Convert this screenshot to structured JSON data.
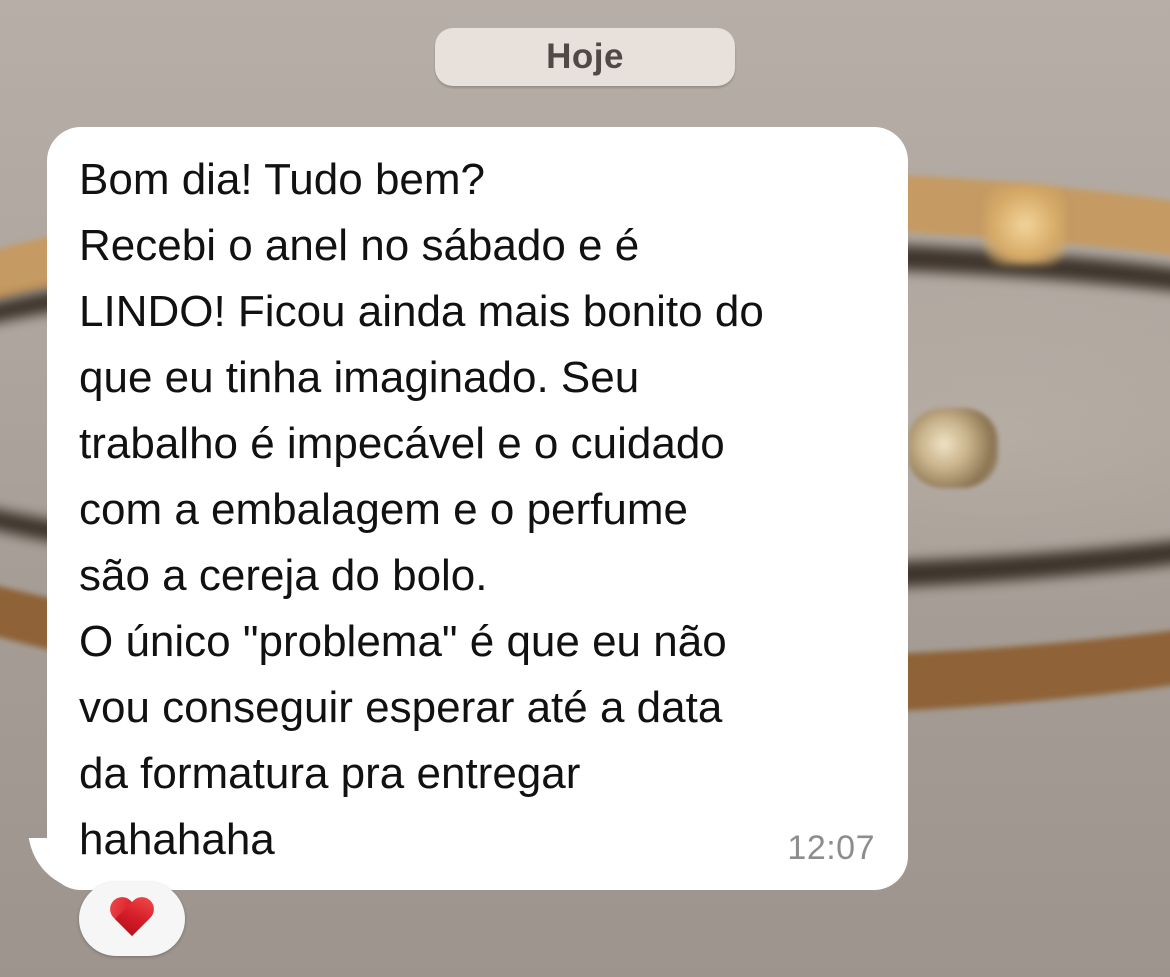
{
  "date_divider": {
    "label": "Hoje"
  },
  "message": {
    "lines": [
      "Bom dia! Tudo bem?",
      "Recebi o anel no sábado e é",
      "LINDO! Ficou ainda mais bonito do",
      "que eu tinha imaginado. Seu",
      "trabalho é impecável e o cuidado",
      "com a embalagem e o perfume",
      "são a cereja do bolo.",
      "O único \"problema\" é que eu não",
      "vou conseguir esperar até a data",
      "da formatura pra entregar",
      "hahahaha"
    ],
    "time": "12:07"
  },
  "reaction": {
    "emoji_icon": "red-heart-icon"
  },
  "colors": {
    "bubble": "#ffffff",
    "date_chip": "#e8e1db",
    "timestamp": "#8d8d90",
    "heart": "#d71f2a"
  }
}
